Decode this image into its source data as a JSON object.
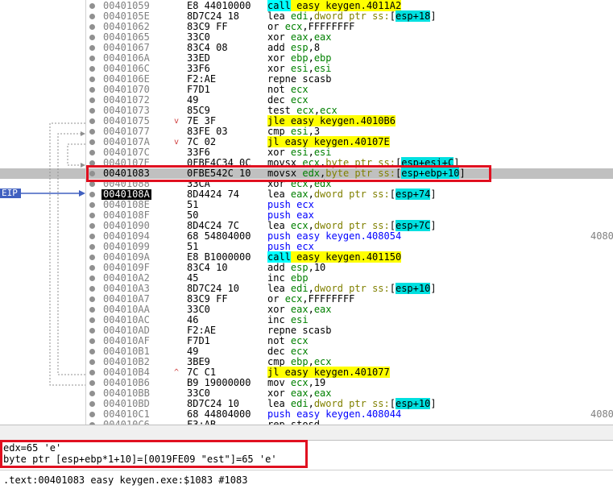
{
  "eip_label": "EIP",
  "rows": [
    {
      "addr": "00401059",
      "bytes": "E8 44010000",
      "instr": [
        {
          "t": "call",
          "c": "mn-call"
        },
        {
          "t": " easy keygen.4011A2",
          "c": "tgt"
        }
      ]
    },
    {
      "addr": "0040105E",
      "bytes": "8D7C24 18",
      "instr": [
        {
          "t": "lea "
        },
        {
          "t": "edi",
          "c": "reg"
        },
        {
          "t": ","
        },
        {
          "t": "dword ptr ss:",
          "c": "ptrv"
        },
        {
          "t": "["
        },
        {
          "t": "esp+18",
          "c": "br"
        },
        {
          "t": "]"
        }
      ]
    },
    {
      "addr": "00401062",
      "bytes": "83C9 FF",
      "instr": [
        {
          "t": "or "
        },
        {
          "t": "ecx",
          "c": "reg"
        },
        {
          "t": ",FFFFFFFF"
        }
      ]
    },
    {
      "addr": "00401065",
      "bytes": "33C0",
      "instr": [
        {
          "t": "xor "
        },
        {
          "t": "eax",
          "c": "reg"
        },
        {
          "t": ","
        },
        {
          "t": "eax",
          "c": "reg"
        }
      ]
    },
    {
      "addr": "00401067",
      "bytes": "83C4 08",
      "instr": [
        {
          "t": "add "
        },
        {
          "t": "esp",
          "c": "reg"
        },
        {
          "t": ",8"
        }
      ]
    },
    {
      "addr": "0040106A",
      "bytes": "33ED",
      "instr": [
        {
          "t": "xor "
        },
        {
          "t": "ebp",
          "c": "reg"
        },
        {
          "t": ","
        },
        {
          "t": "ebp",
          "c": "reg"
        }
      ]
    },
    {
      "addr": "0040106C",
      "bytes": "33F6",
      "instr": [
        {
          "t": "xor "
        },
        {
          "t": "esi",
          "c": "reg"
        },
        {
          "t": ","
        },
        {
          "t": "esi",
          "c": "reg"
        }
      ]
    },
    {
      "addr": "0040106E",
      "bytes": "F2:AE",
      "instr": [
        {
          "t": "repne scasb"
        }
      ]
    },
    {
      "addr": "00401070",
      "bytes": "F7D1",
      "instr": [
        {
          "t": "not "
        },
        {
          "t": "ecx",
          "c": "reg"
        }
      ]
    },
    {
      "addr": "00401072",
      "bytes": "49",
      "instr": [
        {
          "t": "dec "
        },
        {
          "t": "ecx",
          "c": "reg"
        }
      ]
    },
    {
      "addr": "00401073",
      "bytes": "85C9",
      "instr": [
        {
          "t": "test "
        },
        {
          "t": "ecx",
          "c": "reg"
        },
        {
          "t": ","
        },
        {
          "t": "ecx",
          "c": "reg"
        }
      ]
    },
    {
      "addr": "00401075",
      "jm": "v",
      "bytes": "7E 3F",
      "instr": [
        {
          "t": "jle",
          "c": "mn-jmp"
        },
        {
          "t": " easy keygen.4010B6",
          "c": "tgt"
        }
      ]
    },
    {
      "addr": "00401077",
      "bytes": "83FE 03",
      "instr": [
        {
          "t": "cmp "
        },
        {
          "t": "esi",
          "c": "reg"
        },
        {
          "t": ",3"
        }
      ]
    },
    {
      "addr": "0040107A",
      "jm": "v",
      "bytes": "7C 02",
      "instr": [
        {
          "t": "jl",
          "c": "mn-jmp"
        },
        {
          "t": " easy keygen.40107E",
          "c": "tgt"
        }
      ]
    },
    {
      "addr": "0040107C",
      "bytes": "33F6",
      "instr": [
        {
          "t": "xor "
        },
        {
          "t": "esi",
          "c": "reg"
        },
        {
          "t": ","
        },
        {
          "t": "esi",
          "c": "reg"
        }
      ]
    },
    {
      "addr": "0040107E",
      "bytes": "0FBE4C34 0C",
      "instr": [
        {
          "t": "movsx "
        },
        {
          "t": "ecx",
          "c": "reg"
        },
        {
          "t": ","
        },
        {
          "t": "byte ptr ss:",
          "c": "ptrv"
        },
        {
          "t": "["
        },
        {
          "t": "esp+esi+C",
          "c": "br"
        },
        {
          "t": "]"
        }
      ]
    },
    {
      "addr": "00401083",
      "cur": true,
      "sel": true,
      "bytes": "0FBE542C 10",
      "instr": [
        {
          "t": "movsx "
        },
        {
          "t": "edx",
          "c": "reg"
        },
        {
          "t": ","
        },
        {
          "t": "byte ptr ss:",
          "c": "ptrv"
        },
        {
          "t": "["
        },
        {
          "t": "esp+ebp+10",
          "c": "br"
        },
        {
          "t": "]"
        }
      ]
    },
    {
      "addr": "00401088",
      "bytes": "33CA",
      "instr": [
        {
          "t": "xor "
        },
        {
          "t": "ecx",
          "c": "reg"
        },
        {
          "t": ","
        },
        {
          "t": "edx",
          "c": "reg"
        }
      ]
    },
    {
      "addr": "0040108A",
      "eip": true,
      "bytes": "8D4424 74",
      "instr": [
        {
          "t": "lea "
        },
        {
          "t": "eax",
          "c": "reg"
        },
        {
          "t": ","
        },
        {
          "t": "dword ptr ss:",
          "c": "ptrv"
        },
        {
          "t": "["
        },
        {
          "t": "esp+74",
          "c": "br"
        },
        {
          "t": "]"
        }
      ]
    },
    {
      "addr": "0040108E",
      "bytes": "51",
      "instr": [
        {
          "t": "push ecx",
          "c": "mn-push"
        }
      ]
    },
    {
      "addr": "0040108F",
      "bytes": "50",
      "instr": [
        {
          "t": "push eax",
          "c": "mn-push"
        }
      ]
    },
    {
      "addr": "00401090",
      "bytes": "8D4C24 7C",
      "instr": [
        {
          "t": "lea "
        },
        {
          "t": "ecx",
          "c": "reg"
        },
        {
          "t": ","
        },
        {
          "t": "dword ptr ss:",
          "c": "ptrv"
        },
        {
          "t": "["
        },
        {
          "t": "esp+7C",
          "c": "br"
        },
        {
          "t": "]"
        }
      ]
    },
    {
      "addr": "00401094",
      "bytes": "68 54804000",
      "instr": [
        {
          "t": "push easy keygen.408054",
          "c": "mn-push"
        }
      ],
      "extra": "4080"
    },
    {
      "addr": "00401099",
      "bytes": "51",
      "instr": [
        {
          "t": "push ecx",
          "c": "mn-push"
        }
      ]
    },
    {
      "addr": "0040109A",
      "bytes": "E8 B1000000",
      "instr": [
        {
          "t": "call",
          "c": "mn-call"
        },
        {
          "t": " easy keygen.401150",
          "c": "tgt"
        }
      ]
    },
    {
      "addr": "0040109F",
      "bytes": "83C4 10",
      "instr": [
        {
          "t": "add "
        },
        {
          "t": "esp",
          "c": "reg"
        },
        {
          "t": ",10"
        }
      ]
    },
    {
      "addr": "004010A2",
      "bytes": "45",
      "instr": [
        {
          "t": "inc "
        },
        {
          "t": "ebp",
          "c": "reg"
        }
      ]
    },
    {
      "addr": "004010A3",
      "bytes": "8D7C24 10",
      "instr": [
        {
          "t": "lea "
        },
        {
          "t": "edi",
          "c": "reg"
        },
        {
          "t": ","
        },
        {
          "t": "dword ptr ss:",
          "c": "ptrv"
        },
        {
          "t": "["
        },
        {
          "t": "esp+10",
          "c": "br"
        },
        {
          "t": "]"
        }
      ]
    },
    {
      "addr": "004010A7",
      "bytes": "83C9 FF",
      "instr": [
        {
          "t": "or "
        },
        {
          "t": "ecx",
          "c": "reg"
        },
        {
          "t": ",FFFFFFFF"
        }
      ]
    },
    {
      "addr": "004010AA",
      "bytes": "33C0",
      "instr": [
        {
          "t": "xor "
        },
        {
          "t": "eax",
          "c": "reg"
        },
        {
          "t": ","
        },
        {
          "t": "eax",
          "c": "reg"
        }
      ]
    },
    {
      "addr": "004010AC",
      "bytes": "46",
      "instr": [
        {
          "t": "inc "
        },
        {
          "t": "esi",
          "c": "reg"
        }
      ]
    },
    {
      "addr": "004010AD",
      "bytes": "F2:AE",
      "instr": [
        {
          "t": "repne scasb"
        }
      ]
    },
    {
      "addr": "004010AF",
      "bytes": "F7D1",
      "instr": [
        {
          "t": "not "
        },
        {
          "t": "ecx",
          "c": "reg"
        }
      ]
    },
    {
      "addr": "004010B1",
      "bytes": "49",
      "instr": [
        {
          "t": "dec "
        },
        {
          "t": "ecx",
          "c": "reg"
        }
      ]
    },
    {
      "addr": "004010B2",
      "bytes": "3BE9",
      "instr": [
        {
          "t": "cmp "
        },
        {
          "t": "ebp",
          "c": "reg"
        },
        {
          "t": ","
        },
        {
          "t": "ecx",
          "c": "reg"
        }
      ]
    },
    {
      "addr": "004010B4",
      "jm": "^",
      "bytes": "7C C1",
      "instr": [
        {
          "t": "jl",
          "c": "mn-jmp"
        },
        {
          "t": " easy keygen.401077",
          "c": "tgt"
        }
      ]
    },
    {
      "addr": "004010B6",
      "bytes": "B9 19000000",
      "instr": [
        {
          "t": "mov "
        },
        {
          "t": "ecx",
          "c": "reg"
        },
        {
          "t": ",19"
        }
      ]
    },
    {
      "addr": "004010BB",
      "bytes": "33C0",
      "instr": [
        {
          "t": "xor "
        },
        {
          "t": "eax",
          "c": "reg"
        },
        {
          "t": ","
        },
        {
          "t": "eax",
          "c": "reg"
        }
      ]
    },
    {
      "addr": "004010BD",
      "bytes": "8D7C24 10",
      "instr": [
        {
          "t": "lea "
        },
        {
          "t": "edi",
          "c": "reg"
        },
        {
          "t": ","
        },
        {
          "t": "dword ptr ss:",
          "c": "ptrv"
        },
        {
          "t": "["
        },
        {
          "t": "esp+10",
          "c": "br"
        },
        {
          "t": "]"
        }
      ]
    },
    {
      "addr": "004010C1",
      "bytes": "68 44804000",
      "instr": [
        {
          "t": "push easy keygen.408044",
          "c": "mn-push"
        }
      ],
      "extra": "4080"
    },
    {
      "addr": "004010C6",
      "bytes": "F3:AB",
      "instr": [
        {
          "t": "rep stosd"
        }
      ]
    }
  ],
  "info": {
    "line1": "edx=65 'e'",
    "line2": "byte ptr [esp+ebp*1+10]=[0019FE09 \"est\"]=65 'e'"
  },
  "status": ".text:00401083 easy keygen.exe:$1083 #1083"
}
